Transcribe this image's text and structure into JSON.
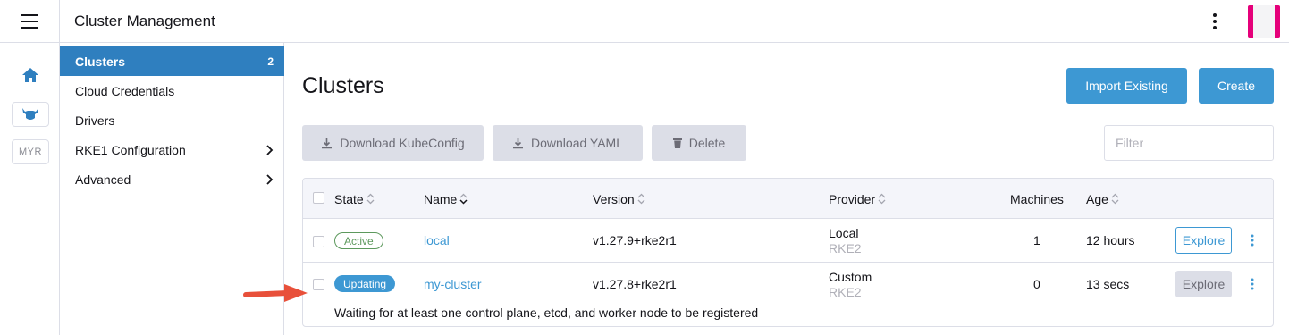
{
  "header": {
    "title": "Cluster Management",
    "avatar_colors": {
      "accent": "#e5007a",
      "bg": "#f4f4f6"
    }
  },
  "rail": {
    "home_icon": "home-icon",
    "cluster_icon": "cluster-steer-icon",
    "myr_label": "MYR"
  },
  "sidenav": {
    "items": [
      {
        "label": "Clusters",
        "count": "2",
        "active": true
      },
      {
        "label": "Cloud Credentials"
      },
      {
        "label": "Drivers"
      },
      {
        "label": "RKE1 Configuration",
        "expandable": true
      },
      {
        "label": "Advanced",
        "expandable": true
      }
    ]
  },
  "main": {
    "title": "Clusters",
    "import_label": "Import Existing",
    "create_label": "Create",
    "bulk": {
      "kubeconfig_label": "Download KubeConfig",
      "yaml_label": "Download YAML",
      "delete_label": "Delete"
    },
    "filter_placeholder": "Filter"
  },
  "table": {
    "headers": {
      "state": "State",
      "name": "Name",
      "version": "Version",
      "provider": "Provider",
      "machines": "Machines",
      "age": "Age"
    },
    "rows": [
      {
        "state": "Active",
        "name": "local",
        "version": "v1.27.9+rke2r1",
        "provider": "Local",
        "provider_sub": "RKE2",
        "machines": "1",
        "age": "12 hours",
        "explore_label": "Explore"
      },
      {
        "state": "Updating",
        "name": "my-cluster",
        "version": "v1.27.8+rke2r1",
        "provider": "Custom",
        "provider_sub": "RKE2",
        "machines": "0",
        "age": "13 secs",
        "explore_label": "Explore",
        "message": "Waiting for at least one control plane, etcd, and worker node to be registered"
      }
    ]
  },
  "colors": {
    "primary": "#3d98d3",
    "nav_active": "#2f7fbf",
    "active_badge": "#5d995d",
    "arrow": "#e8503a"
  }
}
